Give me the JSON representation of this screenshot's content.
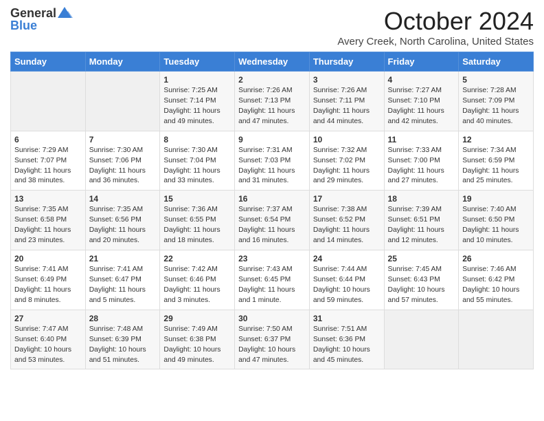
{
  "logo": {
    "text_general": "General",
    "text_blue": "Blue"
  },
  "header": {
    "month": "October 2024",
    "location": "Avery Creek, North Carolina, United States"
  },
  "days_of_week": [
    "Sunday",
    "Monday",
    "Tuesday",
    "Wednesday",
    "Thursday",
    "Friday",
    "Saturday"
  ],
  "weeks": [
    [
      {
        "day": "",
        "sunrise": "",
        "sunset": "",
        "daylight": ""
      },
      {
        "day": "",
        "sunrise": "",
        "sunset": "",
        "daylight": ""
      },
      {
        "day": "1",
        "sunrise": "Sunrise: 7:25 AM",
        "sunset": "Sunset: 7:14 PM",
        "daylight": "Daylight: 11 hours and 49 minutes."
      },
      {
        "day": "2",
        "sunrise": "Sunrise: 7:26 AM",
        "sunset": "Sunset: 7:13 PM",
        "daylight": "Daylight: 11 hours and 47 minutes."
      },
      {
        "day": "3",
        "sunrise": "Sunrise: 7:26 AM",
        "sunset": "Sunset: 7:11 PM",
        "daylight": "Daylight: 11 hours and 44 minutes."
      },
      {
        "day": "4",
        "sunrise": "Sunrise: 7:27 AM",
        "sunset": "Sunset: 7:10 PM",
        "daylight": "Daylight: 11 hours and 42 minutes."
      },
      {
        "day": "5",
        "sunrise": "Sunrise: 7:28 AM",
        "sunset": "Sunset: 7:09 PM",
        "daylight": "Daylight: 11 hours and 40 minutes."
      }
    ],
    [
      {
        "day": "6",
        "sunrise": "Sunrise: 7:29 AM",
        "sunset": "Sunset: 7:07 PM",
        "daylight": "Daylight: 11 hours and 38 minutes."
      },
      {
        "day": "7",
        "sunrise": "Sunrise: 7:30 AM",
        "sunset": "Sunset: 7:06 PM",
        "daylight": "Daylight: 11 hours and 36 minutes."
      },
      {
        "day": "8",
        "sunrise": "Sunrise: 7:30 AM",
        "sunset": "Sunset: 7:04 PM",
        "daylight": "Daylight: 11 hours and 33 minutes."
      },
      {
        "day": "9",
        "sunrise": "Sunrise: 7:31 AM",
        "sunset": "Sunset: 7:03 PM",
        "daylight": "Daylight: 11 hours and 31 minutes."
      },
      {
        "day": "10",
        "sunrise": "Sunrise: 7:32 AM",
        "sunset": "Sunset: 7:02 PM",
        "daylight": "Daylight: 11 hours and 29 minutes."
      },
      {
        "day": "11",
        "sunrise": "Sunrise: 7:33 AM",
        "sunset": "Sunset: 7:00 PM",
        "daylight": "Daylight: 11 hours and 27 minutes."
      },
      {
        "day": "12",
        "sunrise": "Sunrise: 7:34 AM",
        "sunset": "Sunset: 6:59 PM",
        "daylight": "Daylight: 11 hours and 25 minutes."
      }
    ],
    [
      {
        "day": "13",
        "sunrise": "Sunrise: 7:35 AM",
        "sunset": "Sunset: 6:58 PM",
        "daylight": "Daylight: 11 hours and 23 minutes."
      },
      {
        "day": "14",
        "sunrise": "Sunrise: 7:35 AM",
        "sunset": "Sunset: 6:56 PM",
        "daylight": "Daylight: 11 hours and 20 minutes."
      },
      {
        "day": "15",
        "sunrise": "Sunrise: 7:36 AM",
        "sunset": "Sunset: 6:55 PM",
        "daylight": "Daylight: 11 hours and 18 minutes."
      },
      {
        "day": "16",
        "sunrise": "Sunrise: 7:37 AM",
        "sunset": "Sunset: 6:54 PM",
        "daylight": "Daylight: 11 hours and 16 minutes."
      },
      {
        "day": "17",
        "sunrise": "Sunrise: 7:38 AM",
        "sunset": "Sunset: 6:52 PM",
        "daylight": "Daylight: 11 hours and 14 minutes."
      },
      {
        "day": "18",
        "sunrise": "Sunrise: 7:39 AM",
        "sunset": "Sunset: 6:51 PM",
        "daylight": "Daylight: 11 hours and 12 minutes."
      },
      {
        "day": "19",
        "sunrise": "Sunrise: 7:40 AM",
        "sunset": "Sunset: 6:50 PM",
        "daylight": "Daylight: 11 hours and 10 minutes."
      }
    ],
    [
      {
        "day": "20",
        "sunrise": "Sunrise: 7:41 AM",
        "sunset": "Sunset: 6:49 PM",
        "daylight": "Daylight: 11 hours and 8 minutes."
      },
      {
        "day": "21",
        "sunrise": "Sunrise: 7:41 AM",
        "sunset": "Sunset: 6:47 PM",
        "daylight": "Daylight: 11 hours and 5 minutes."
      },
      {
        "day": "22",
        "sunrise": "Sunrise: 7:42 AM",
        "sunset": "Sunset: 6:46 PM",
        "daylight": "Daylight: 11 hours and 3 minutes."
      },
      {
        "day": "23",
        "sunrise": "Sunrise: 7:43 AM",
        "sunset": "Sunset: 6:45 PM",
        "daylight": "Daylight: 11 hours and 1 minute."
      },
      {
        "day": "24",
        "sunrise": "Sunrise: 7:44 AM",
        "sunset": "Sunset: 6:44 PM",
        "daylight": "Daylight: 10 hours and 59 minutes."
      },
      {
        "day": "25",
        "sunrise": "Sunrise: 7:45 AM",
        "sunset": "Sunset: 6:43 PM",
        "daylight": "Daylight: 10 hours and 57 minutes."
      },
      {
        "day": "26",
        "sunrise": "Sunrise: 7:46 AM",
        "sunset": "Sunset: 6:42 PM",
        "daylight": "Daylight: 10 hours and 55 minutes."
      }
    ],
    [
      {
        "day": "27",
        "sunrise": "Sunrise: 7:47 AM",
        "sunset": "Sunset: 6:40 PM",
        "daylight": "Daylight: 10 hours and 53 minutes."
      },
      {
        "day": "28",
        "sunrise": "Sunrise: 7:48 AM",
        "sunset": "Sunset: 6:39 PM",
        "daylight": "Daylight: 10 hours and 51 minutes."
      },
      {
        "day": "29",
        "sunrise": "Sunrise: 7:49 AM",
        "sunset": "Sunset: 6:38 PM",
        "daylight": "Daylight: 10 hours and 49 minutes."
      },
      {
        "day": "30",
        "sunrise": "Sunrise: 7:50 AM",
        "sunset": "Sunset: 6:37 PM",
        "daylight": "Daylight: 10 hours and 47 minutes."
      },
      {
        "day": "31",
        "sunrise": "Sunrise: 7:51 AM",
        "sunset": "Sunset: 6:36 PM",
        "daylight": "Daylight: 10 hours and 45 minutes."
      },
      {
        "day": "",
        "sunrise": "",
        "sunset": "",
        "daylight": ""
      },
      {
        "day": "",
        "sunrise": "",
        "sunset": "",
        "daylight": ""
      }
    ]
  ]
}
